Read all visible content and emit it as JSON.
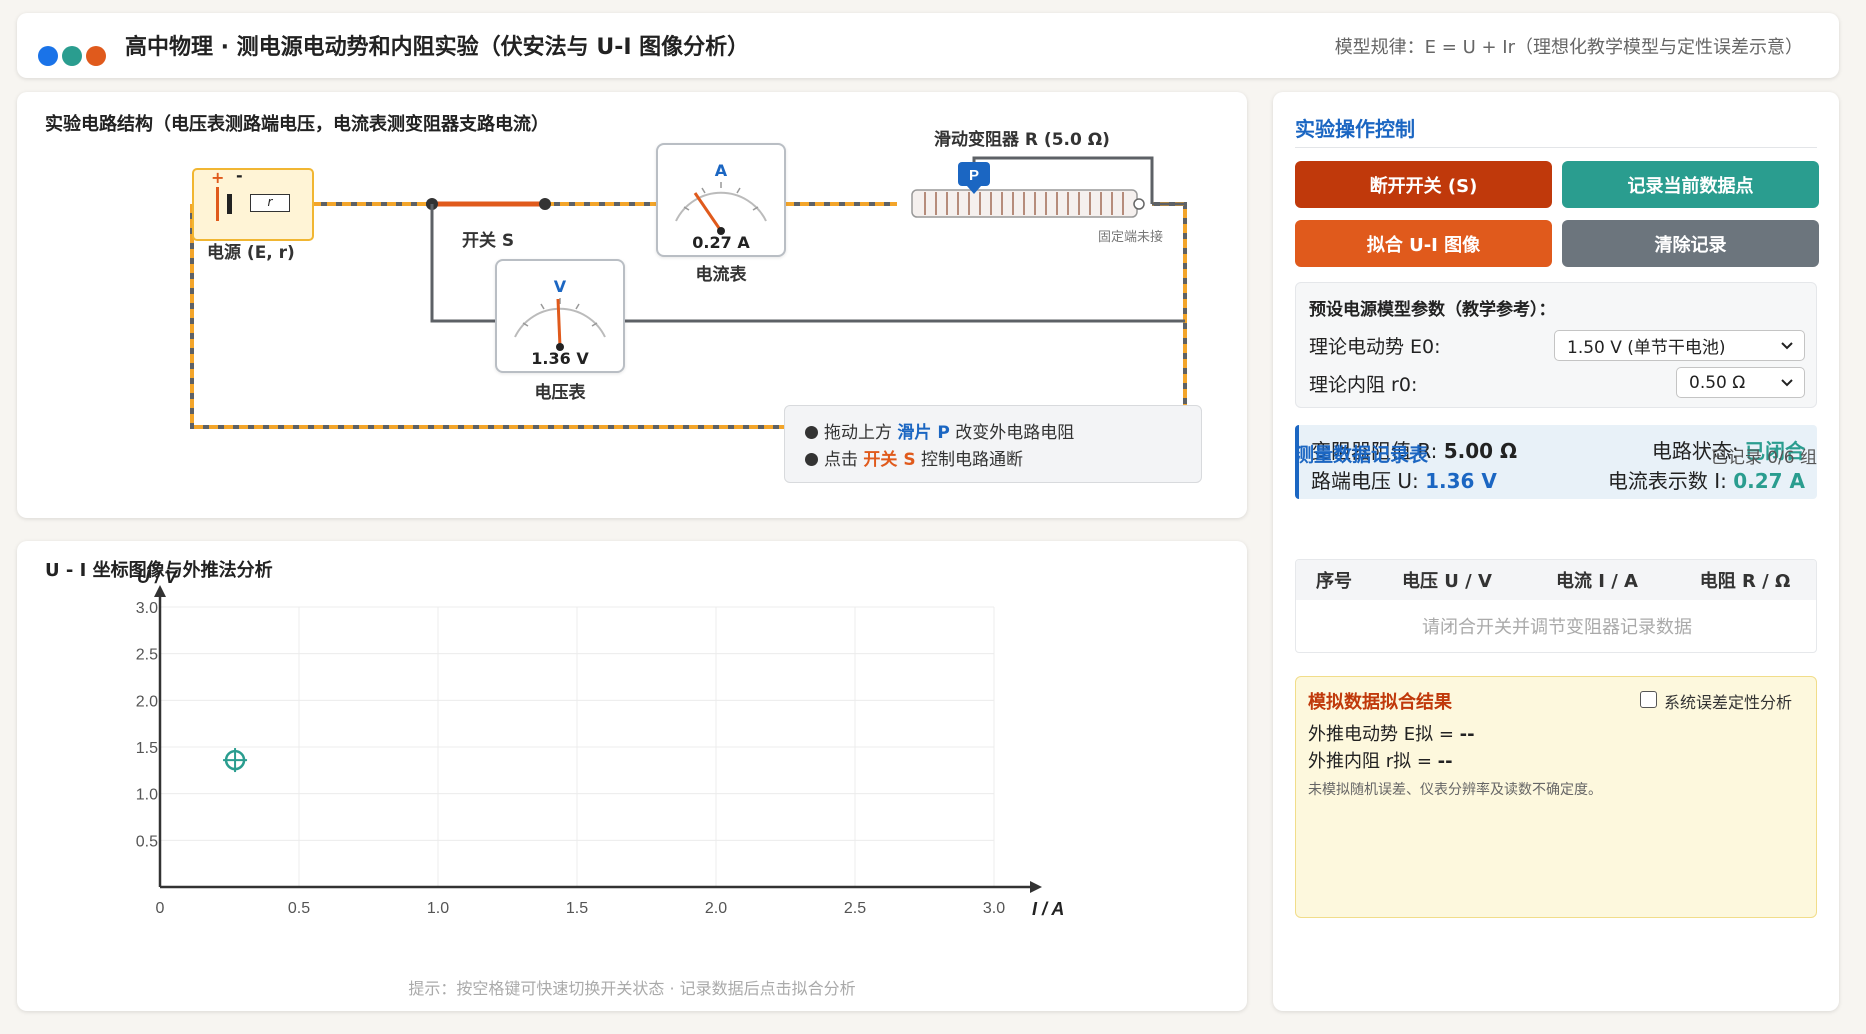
{
  "header": {
    "title": "高中物理 · 测电源电动势和内阻实验（伏安法与 U-I 图像分析）",
    "model_rule": "模型规律：E = U + Ir（理想化教学模型与定性误差示意）",
    "dot_colors": [
      "#1a73e8",
      "#2a9d8f",
      "#e76f51"
    ]
  },
  "circuit": {
    "title": "实验电路结构（电压表测路端电压，电流表测变阻器支路电流）",
    "source_label": "电源 (E, r)",
    "source_plus": "+",
    "source_minus": "-",
    "source_r": "r",
    "switch_label": "开关 S",
    "ammeter": {
      "symbol": "A",
      "reading": "0.27 A",
      "label": "电流表"
    },
    "voltmeter": {
      "symbol": "V",
      "reading": "1.36 V",
      "label": "电压表"
    },
    "rheostat_label": "滑动变阻器 R (5.0 Ω)",
    "slider_label": "P",
    "fixed_end_label": "固定端未接",
    "instructions": [
      {
        "prefix": "拖动上方 ",
        "highlight": "滑片 P",
        "suffix": " 改变外电路电阻",
        "color": "#1b66c2"
      },
      {
        "prefix": "点击 ",
        "highlight": "开关 S",
        "suffix": " 控制电路通断",
        "color": "#e05a1c"
      }
    ]
  },
  "graph": {
    "title": "U - I 坐标图像与外推法分析",
    "hint": "提示：按空格键可快速切换开关状态 · 记录数据后点击拟合分析"
  },
  "chart_data": {
    "type": "scatter",
    "xlabel": "I / A",
    "ylabel": "U / V",
    "xlim": [
      0,
      3.0
    ],
    "ylim": [
      0,
      3.0
    ],
    "x_ticks": [
      "0",
      "0.5",
      "1.0",
      "1.5",
      "2.0",
      "2.5",
      "3.0"
    ],
    "y_ticks": [
      "0.5",
      "1.0",
      "1.5",
      "2.0",
      "2.5",
      "3.0"
    ],
    "grid": true,
    "series": [
      {
        "points": [
          [
            0.27,
            1.36
          ]
        ],
        "color": "#2a9d8f",
        "marker": "crosshair-circle"
      }
    ]
  },
  "controls": {
    "title": "实验操作控制",
    "buttons": {
      "switch": "断开开关 (S)",
      "record": "记录当前数据点",
      "fit": "拟合 U-I 图像",
      "clear": "清除记录"
    },
    "button_colors": {
      "switch": "#c0390b",
      "record": "#2a9d8f",
      "fit": "#e05a1c",
      "clear": "#6c757d"
    },
    "params": {
      "title": "预设电源模型参数（教学参考）：",
      "emf_label": "理论电动势 E0:",
      "emf_value": "1.50 V (单节干电池)",
      "r_label": "理论内阻 r0:",
      "r_value": "0.50 Ω"
    },
    "status": {
      "r_label": "变阻器阻值 R:",
      "r_value": "5.00 Ω",
      "state_label": "电路状态:",
      "state_value": "已闭合",
      "u_label": "路端电压 U:",
      "u_value": "1.36 V",
      "i_label": "电流表示数 I:",
      "i_value": "0.27 A"
    },
    "table": {
      "title": "测量数据记录表",
      "count": "已记录 0/6 组",
      "headers": [
        "序号",
        "电压 U / V",
        "电流 I / A",
        "电阻 R / Ω"
      ],
      "empty": "请闭合开关并调节变阻器记录数据"
    },
    "fit": {
      "title": "模拟数据拟合结果",
      "checkbox_label": "系统误差定性分析",
      "emf_label": "外推电动势 E拟 =",
      "emf_value": "--",
      "r_label": "外推内阻 r拟 =",
      "r_value": "--",
      "note": "未模拟随机误差、仪表分辨率及读数不确定度。"
    }
  }
}
